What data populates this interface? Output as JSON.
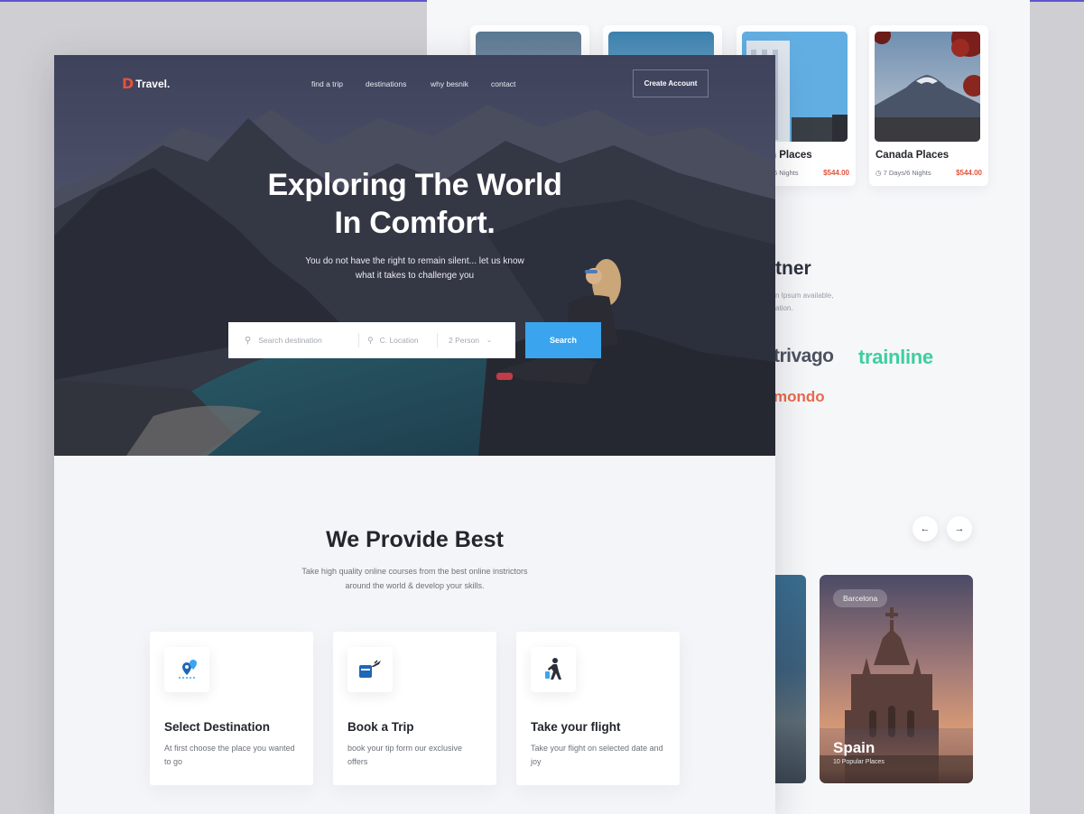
{
  "brand": {
    "mark": "D",
    "name": "Travel."
  },
  "nav": {
    "items": [
      "find a trip",
      "destinations",
      "why besnik",
      "contact"
    ],
    "create_account": "Create Account"
  },
  "hero": {
    "title_line1": "Exploring The World",
    "title_line2": "In Comfort.",
    "subtitle_line1": "You do not have the right to remain silent... let us know",
    "subtitle_line2": "what it takes to challenge you"
  },
  "search": {
    "destination_placeholder": "Search destination",
    "location": "C. Location",
    "persons": "2 Person",
    "button": "Search"
  },
  "provide": {
    "title": "We Provide Best",
    "desc_line1": "Take high quality online courses from the best online instrictors",
    "desc_line2": "around the world & develop your skills."
  },
  "features": [
    {
      "title": "Select Destination",
      "desc": "At first choose the place you wanted to go",
      "icon": "map-pin-icon"
    },
    {
      "title": "Book a Trip",
      "desc": "book your tip form our exclusive offers",
      "icon": "plane-ticket-icon"
    },
    {
      "title": "Take your flight",
      "desc": "Take your flight on selected date and joy",
      "icon": "traveler-icon"
    }
  ],
  "places": [
    {
      "title": "n Places",
      "meta": "6 Nights",
      "price": "$544.00"
    },
    {
      "title": "Canada Places",
      "meta": "7 Days/6 Nights",
      "price": "$544.00"
    }
  ],
  "partners": {
    "title": "tner",
    "desc_line1": "n Ipsum available,",
    "desc_line2": "ation.",
    "logos": [
      "trivago",
      "trainline",
      "mondo"
    ]
  },
  "destination": {
    "tag": "Barcelona",
    "country": "Spain",
    "sub": "10 Popular Places"
  },
  "colors": {
    "accent_blue": "#3aa5ee",
    "brand_red": "#e4523b",
    "trainline_green": "#3ccf9d"
  }
}
